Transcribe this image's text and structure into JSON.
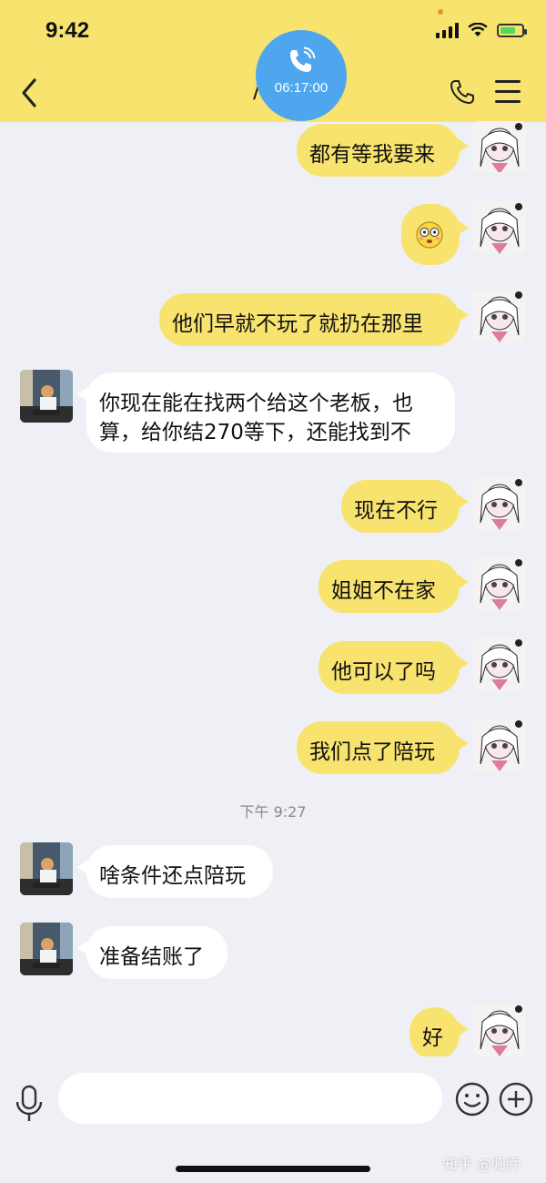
{
  "status_bar": {
    "time": "9:42"
  },
  "header": {
    "title_fragment": "/",
    "call_duration": "06:17:00"
  },
  "messages": [
    {
      "text": "都有等我要来"
    },
    {
      "text": "😳"
    },
    {
      "text": "他们早就不玩了就扔在那里"
    },
    {
      "line1": "你现在能在找两个给这个老板，也",
      "line2": "算，给你结270等下，还能找到不"
    },
    {
      "text": "现在不行"
    },
    {
      "text": "姐姐不在家"
    },
    {
      "text": "他可以了吗"
    },
    {
      "text": "我们点了陪玩"
    },
    {
      "text": "啥条件还点陪玩"
    },
    {
      "text": "准备结账了"
    },
    {
      "text": "好"
    }
  ],
  "timestamp": "下午 9:27",
  "input": {
    "placeholder": ""
  },
  "watermark": "知乎 @归乔",
  "colors": {
    "header": "#f8e36f",
    "outgoing_bubble": "#f8e36f",
    "incoming_bubble": "#ffffff",
    "call_bubble": "#4ea7ee",
    "background": "#eef0f6"
  }
}
